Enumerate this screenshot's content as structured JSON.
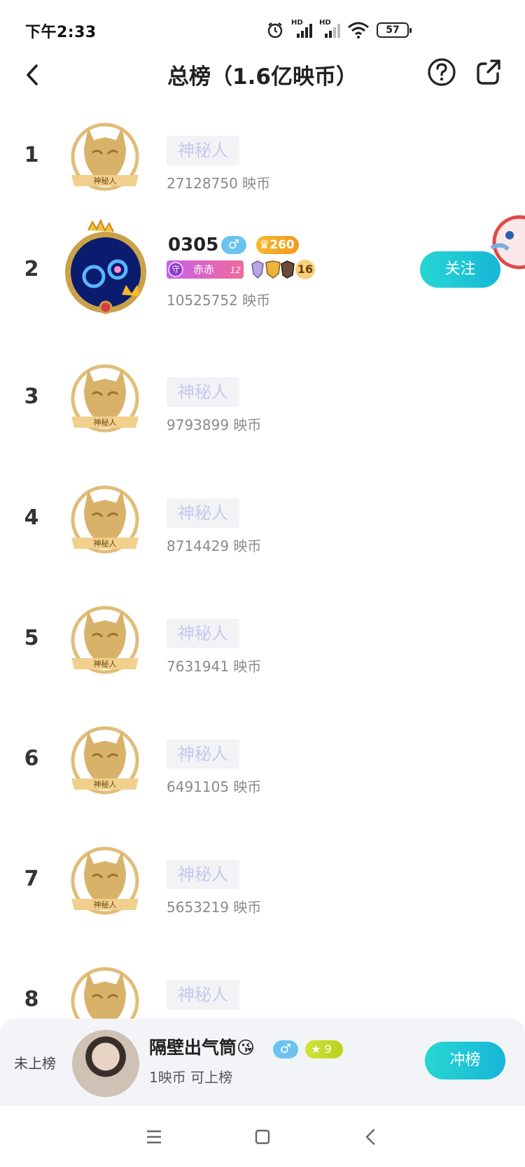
{
  "status_bar": {
    "time": "下午2:33",
    "battery": "57",
    "hd1": "HD",
    "hd2": "HD"
  },
  "nav": {
    "title": "总榜（1.6亿映币）"
  },
  "ranking": [
    {
      "rank": "1",
      "name": "神秘人",
      "coins": "27128750 映币",
      "badge": "神秘人"
    },
    {
      "rank": "2",
      "name": "0305",
      "gender": "♂",
      "crown_level": "260",
      "fan_badge_name": "赤赤",
      "fan_badge_icon": "守",
      "fan_badge_level": "12",
      "medal_count": "16",
      "coins": "10525752 映币",
      "follow_label": "关注"
    },
    {
      "rank": "3",
      "name": "神秘人",
      "coins": "9793899 映币",
      "badge": "神秘人"
    },
    {
      "rank": "4",
      "name": "神秘人",
      "coins": "8714429 映币",
      "badge": "神秘人"
    },
    {
      "rank": "5",
      "name": "神秘人",
      "coins": "7631941 映币",
      "badge": "神秘人"
    },
    {
      "rank": "6",
      "name": "神秘人",
      "coins": "6491105 映币",
      "badge": "神秘人"
    },
    {
      "rank": "7",
      "name": "神秘人",
      "coins": "5653219 映币",
      "badge": "神秘人"
    },
    {
      "rank": "8",
      "name": "神秘人",
      "badge": "神秘人"
    }
  ],
  "my_rank": {
    "label": "未上榜",
    "name": "隔壁出气筒😘",
    "gender": "♂",
    "level": "9",
    "level_icon": "★",
    "sub_text": "1映币 可上榜",
    "button_label": "冲榜"
  },
  "colors": {
    "accent": "#1cc6d6",
    "anon_text": "#c4c9ee",
    "mask_gold": "#d9b26a"
  }
}
